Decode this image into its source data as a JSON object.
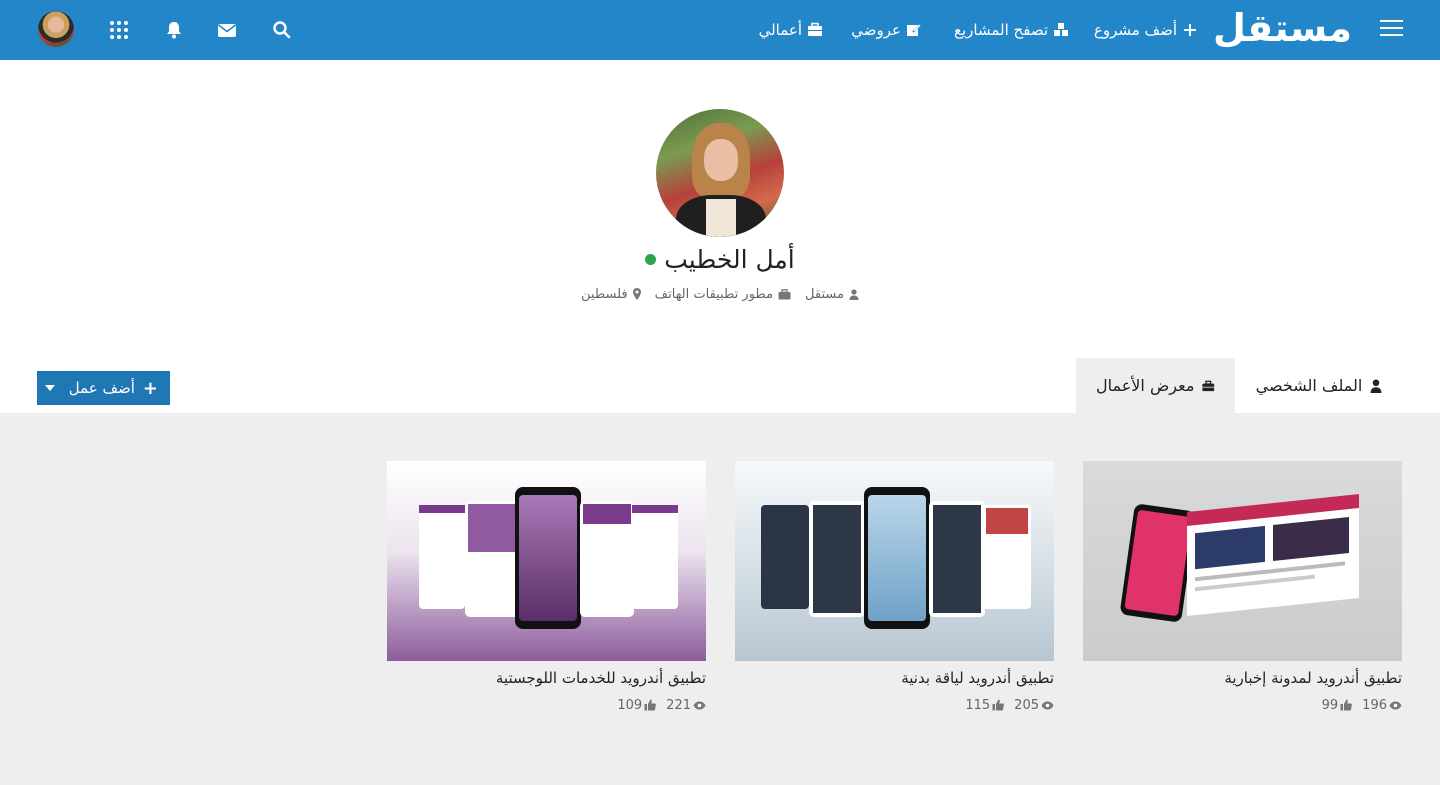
{
  "nav": {
    "logo": "مستقل",
    "add_project": "أضف مشروع",
    "browse_projects": "تصفح المشاريع",
    "my_offers": "عروضي",
    "my_works": "أعمالي"
  },
  "profile": {
    "name": "أمل الخطيب",
    "status": "online",
    "meta": {
      "role_label": "مستقل",
      "title": "مطور تطبيقات الهاتف",
      "location": "فلسطين"
    }
  },
  "tabs": [
    {
      "label": "الملف الشخصي",
      "icon": "user-icon",
      "active": false
    },
    {
      "label": "معرض الأعمال",
      "icon": "briefcase-icon",
      "active": true
    }
  ],
  "add_work_label": "أضف عمل",
  "works": [
    {
      "title": "تطبيق أندرويد لمدونة إخبارية",
      "views": "196",
      "likes": "99"
    },
    {
      "title": "تطبيق أندرويد لياقة بدنية",
      "views": "205",
      "likes": "115"
    },
    {
      "title": "تطبيق أندرويد للخدمات اللوجستية",
      "views": "221",
      "likes": "109"
    }
  ],
  "colors": {
    "brand": "#2386c8",
    "button": "#1f77b4",
    "online": "#2ea44f",
    "page_bg": "#eeeeee"
  }
}
